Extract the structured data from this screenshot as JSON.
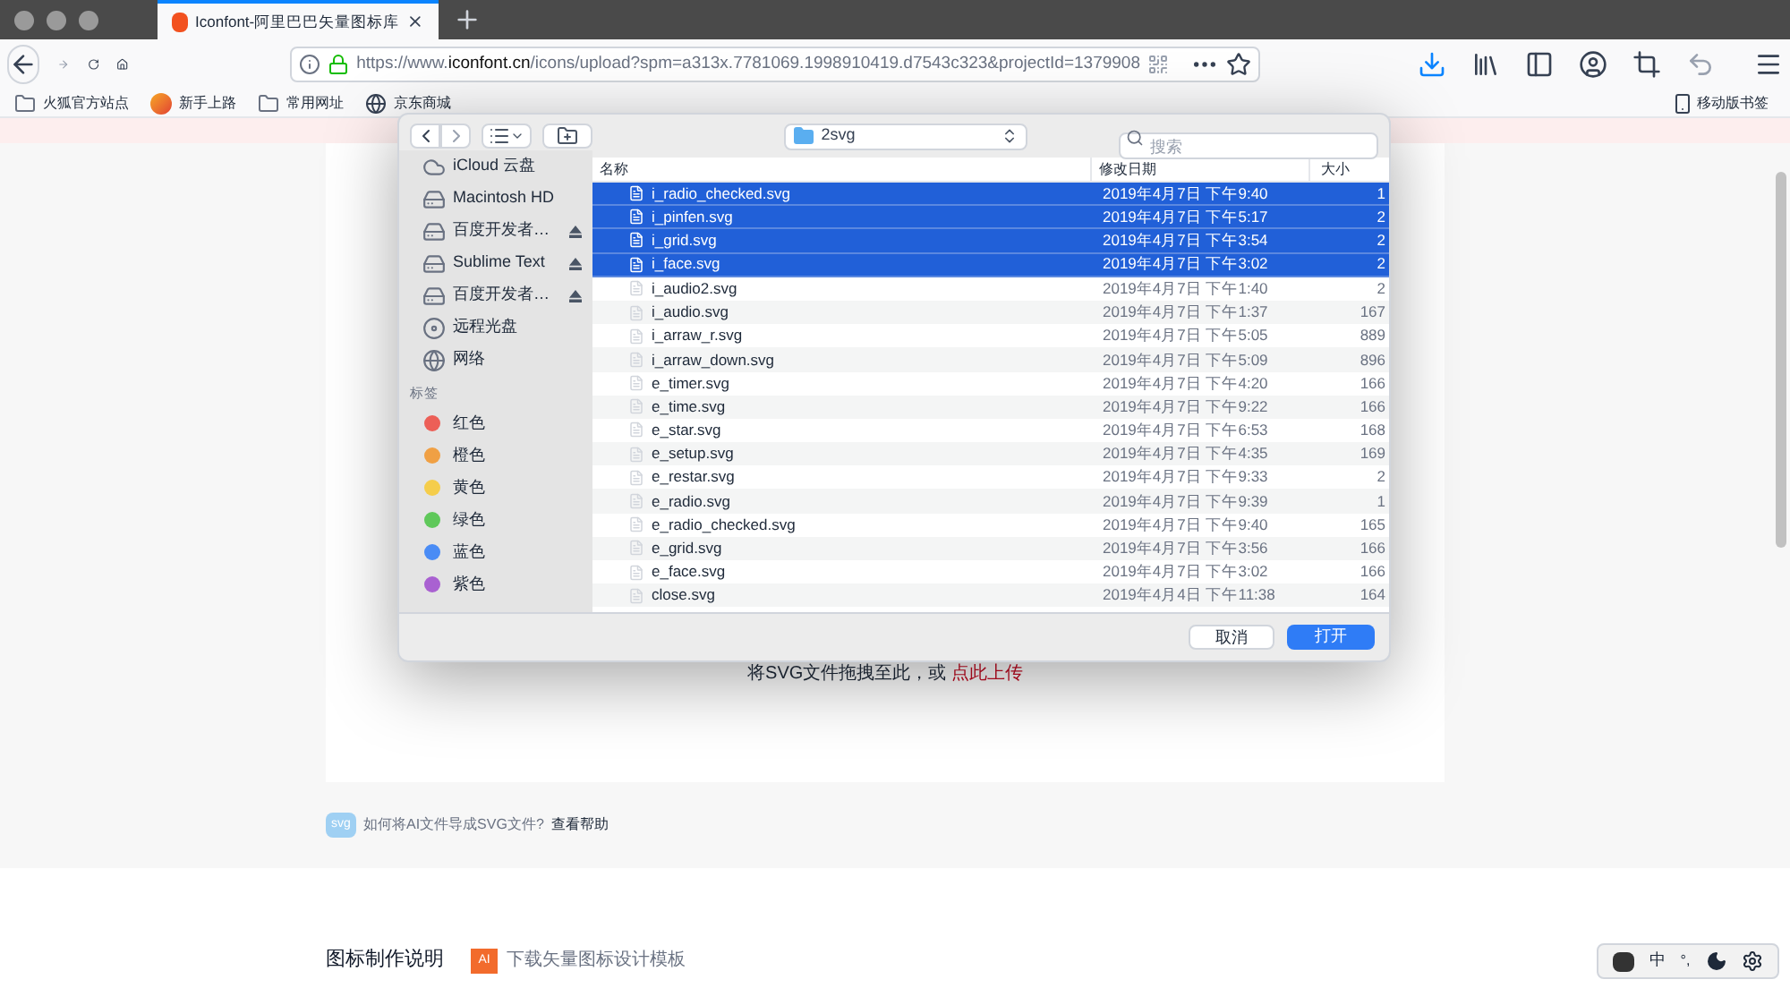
{
  "browser": {
    "tab": {
      "title": "Iconfont-阿里巴巴矢量图标库"
    },
    "url": "https://www.**iconfont.cn**/icons/upload?spm=a313x.7781069.1998910419.d7543c323&projectId=1379908",
    "bookmarks": [
      {
        "label": "火狐官方站点",
        "kind": "folder"
      },
      {
        "label": "新手上路",
        "kind": "firefox"
      },
      {
        "label": "常用网址",
        "kind": "folder"
      },
      {
        "label": "京东商城",
        "kind": "globe"
      }
    ],
    "mobile_bookmarks": "移动版书签"
  },
  "page": {
    "upload_prompt": "将SVG文件拖拽至此，或",
    "upload_link": "点此上传",
    "help_badge": "svg",
    "help_text": "如何将AI文件导成SVG文件?",
    "help_link": "查看帮助",
    "section_title": "图标制作说明",
    "template_badge": "AI",
    "template_link": "下载矢量图标设计模板"
  },
  "dialog": {
    "folder": "2svg",
    "search": {
      "placeholder": "搜索"
    },
    "sidebar": {
      "items": [
        {
          "label": "iCloud 云盘",
          "kind": "cloud"
        },
        {
          "label": "Macintosh HD",
          "kind": "disk"
        },
        {
          "label": "百度开发者…",
          "kind": "ejectable"
        },
        {
          "label": "Sublime Text",
          "kind": "ejectable"
        },
        {
          "label": "百度开发者…",
          "kind": "ejectable"
        },
        {
          "label": "远程光盘",
          "kind": "disc"
        },
        {
          "label": "网络",
          "kind": "network"
        }
      ],
      "tags_heading": "标签",
      "tags": [
        {
          "label": "红色",
          "color": "#ec5f57"
        },
        {
          "label": "橙色",
          "color": "#f0a044"
        },
        {
          "label": "黄色",
          "color": "#f5cd4b"
        },
        {
          "label": "绿色",
          "color": "#5fc85a"
        },
        {
          "label": "蓝色",
          "color": "#4a8cf5"
        },
        {
          "label": "紫色",
          "color": "#a961d1"
        }
      ]
    },
    "columns": [
      "名称",
      "修改日期",
      "大小"
    ],
    "rows": [
      {
        "name": "i_radio_checked.svg",
        "date": "2019年4月7日 下午9:40",
        "size": "1",
        "selected": true
      },
      {
        "name": "i_pinfen.svg",
        "date": "2019年4月7日 下午5:17",
        "size": "2",
        "selected": true
      },
      {
        "name": "i_grid.svg",
        "date": "2019年4月7日 下午3:54",
        "size": "2",
        "selected": true
      },
      {
        "name": "i_face.svg",
        "date": "2019年4月7日 下午3:02",
        "size": "2",
        "selected": true
      },
      {
        "name": "i_audio2.svg",
        "date": "2019年4月7日 下午1:40",
        "size": "2",
        "selected": false
      },
      {
        "name": "i_audio.svg",
        "date": "2019年4月7日 下午1:37",
        "size": "167",
        "selected": false
      },
      {
        "name": "i_arraw_r.svg",
        "date": "2019年4月7日 下午5:05",
        "size": "889",
        "selected": false
      },
      {
        "name": "i_arraw_down.svg",
        "date": "2019年4月7日 下午5:09",
        "size": "896",
        "selected": false
      },
      {
        "name": "e_timer.svg",
        "date": "2019年4月7日 下午4:20",
        "size": "166",
        "selected": false
      },
      {
        "name": "e_time.svg",
        "date": "2019年4月7日 下午9:22",
        "size": "166",
        "selected": false
      },
      {
        "name": "e_star.svg",
        "date": "2019年4月7日 下午6:53",
        "size": "168",
        "selected": false
      },
      {
        "name": "e_setup.svg",
        "date": "2019年4月7日 下午4:35",
        "size": "169",
        "selected": false
      },
      {
        "name": "e_restar.svg",
        "date": "2019年4月7日 下午9:33",
        "size": "2",
        "selected": false
      },
      {
        "name": "e_radio.svg",
        "date": "2019年4月7日 下午9:39",
        "size": "1",
        "selected": false
      },
      {
        "name": "e_radio_checked.svg",
        "date": "2019年4月7日 下午9:40",
        "size": "165",
        "selected": false
      },
      {
        "name": "e_grid.svg",
        "date": "2019年4月7日 下午3:56",
        "size": "166",
        "selected": false
      },
      {
        "name": "e_face.svg",
        "date": "2019年4月7日 下午3:02",
        "size": "166",
        "selected": false
      },
      {
        "name": "close.svg",
        "date": "2019年4月4日 下午11:38",
        "size": "164",
        "selected": false
      }
    ],
    "buttons": {
      "cancel": "取消",
      "open": "打开"
    }
  },
  "ime_bar": {
    "mode": "中",
    "punctuation": "°,"
  }
}
